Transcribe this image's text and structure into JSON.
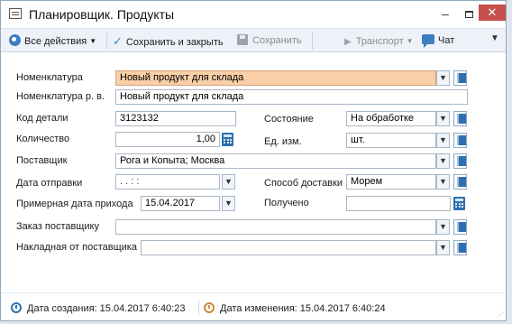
{
  "window": {
    "title": "Планировщик. Продукты",
    "minimize": "–",
    "close": "✕"
  },
  "toolbar": {
    "all_actions": "Все действия",
    "save_close": "Сохранить и закрыть",
    "save": "Сохранить",
    "transport": "Транспорт",
    "chat": "Чат"
  },
  "form": {
    "nomenclature": {
      "label": "Номенклатура",
      "value": "Новый продукт для склада"
    },
    "nomenclature_rv": {
      "label": "Номенклатура р. в.",
      "value": "Новый продукт для склада"
    },
    "part_code": {
      "label": "Код детали",
      "value": "3123132"
    },
    "state": {
      "label": "Состояние",
      "value": "На обработке"
    },
    "quantity": {
      "label": "Количество",
      "value": "1,00"
    },
    "unit": {
      "label": "Ед. изм.",
      "value": "шт."
    },
    "supplier": {
      "label": "Поставщик",
      "value": "Рога и Копыта; Москва"
    },
    "ship_date": {
      "label": "Дата отправки",
      "value": ".   .     :  :"
    },
    "delivery_method": {
      "label": "Способ доставки",
      "value": "Морем"
    },
    "arrival_date": {
      "label": "Примерная дата прихода",
      "value": "15.04.2017"
    },
    "received": {
      "label": "Получено",
      "value": ""
    },
    "supplier_order": {
      "label": "Заказ поставщику",
      "value": ""
    },
    "supplier_invoice": {
      "label": "Накладная от поставщика",
      "value": ""
    }
  },
  "status": {
    "created": "Дата создания: 15.04.2017 6:40:23",
    "modified": "Дата изменения: 15.04.2017 6:40:24"
  },
  "colors": {
    "highlight_field": "#f8cfa7",
    "accent": "#2f6faf",
    "close_button": "#c7504c"
  }
}
